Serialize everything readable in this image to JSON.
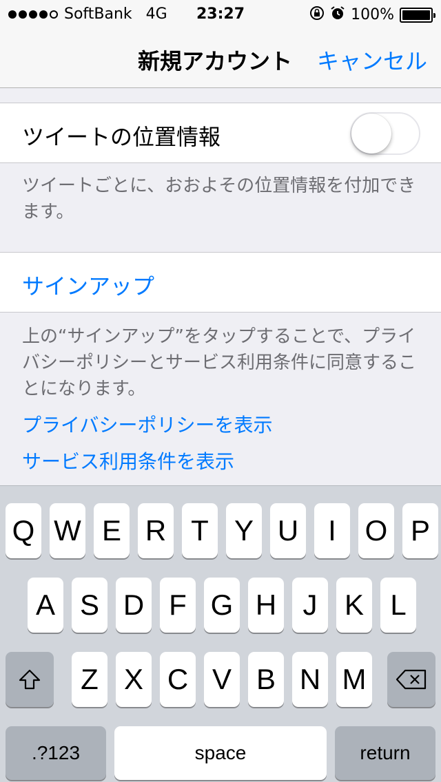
{
  "status_bar": {
    "carrier": "SoftBank",
    "network": "4G",
    "time": "23:27",
    "battery": "100%",
    "icons": [
      "orientation-lock-icon",
      "alarm-icon"
    ]
  },
  "nav": {
    "title": "新規アカウント",
    "cancel_label": "キャンセル"
  },
  "geo_cell": {
    "label": "ツイートの位置情報",
    "toggle_on": false,
    "footer": "ツイートごとに、おおよその位置情報を付加できます。"
  },
  "signup_cell": {
    "label": "サインアップ",
    "footer": "上の“サインアップ”をタップすることで、プライバシーポリシーとサービス利用条件に同意することになります。"
  },
  "links": {
    "privacy": "プライバシーポリシーを表示",
    "terms": "サービス利用条件を表示"
  },
  "keyboard": {
    "row1": [
      "Q",
      "W",
      "E",
      "R",
      "T",
      "Y",
      "U",
      "I",
      "O",
      "P"
    ],
    "row2": [
      "A",
      "S",
      "D",
      "F",
      "G",
      "H",
      "J",
      "K",
      "L"
    ],
    "row3": [
      "Z",
      "X",
      "C",
      "V",
      "B",
      "N",
      "M"
    ],
    "numbers_label": ".?123",
    "space_label": "space",
    "return_label": "return"
  },
  "colors": {
    "accent": "#007aff",
    "background": "#efeff4",
    "footer_text": "#6d6d72",
    "keyboard_bg": "#d1d5db"
  }
}
